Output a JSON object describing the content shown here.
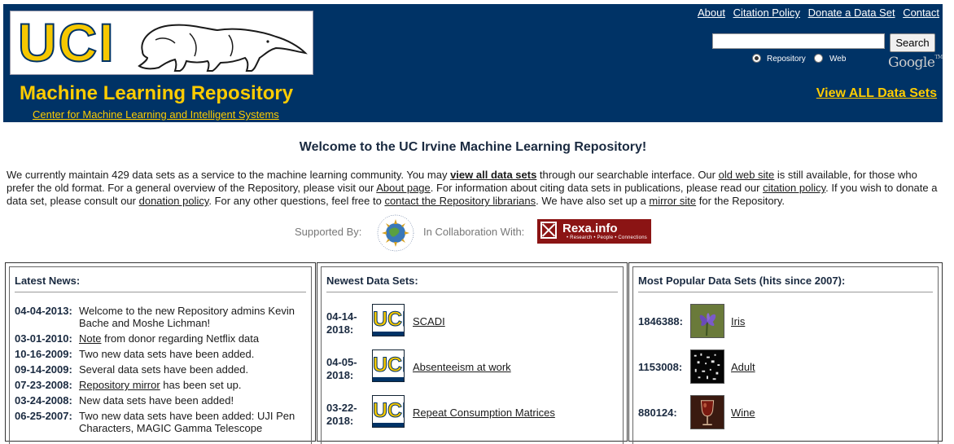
{
  "header": {
    "logo_text": "UCI",
    "title": "Machine Learning Repository",
    "subtitle": "Center for Machine Learning and Intelligent Systems",
    "top_links": [
      "About",
      "Citation Policy",
      "Donate a Data Set",
      "Contact"
    ],
    "search_value": "",
    "search_button": "Search",
    "radio_repository": "Repository",
    "radio_web": "Web",
    "radio_selected": "Repository",
    "google_logo": "Google",
    "view_all": "View ALL Data Sets",
    "brand_color": "#003366",
    "accent_color": "#ffcc00"
  },
  "welcome": {
    "heading": "Welcome to the UC Irvine Machine Learning Repository!",
    "intro_parts": [
      "We currently maintain 429 data sets as a service to the machine learning community. You may ",
      "view all data sets",
      " through our searchable interface. Our ",
      "old web site",
      " is still available, for those who prefer the old format. For a general overview of the Repository, please visit our ",
      "About page",
      ". For information about citing data sets in publications, please read our ",
      "citation policy",
      ". If you wish to donate a data set, please consult our ",
      "donation policy",
      ". For any other questions, feel free to ",
      "contact the Repository librarians",
      ". We have also set up a ",
      "mirror site",
      " for the Repository."
    ],
    "supported_by": "Supported By:",
    "collaboration": "In Collaboration With:",
    "rexa_name": "Rexa.info",
    "rexa_tagline": "• Research • People • Connections"
  },
  "news": {
    "title": "Latest News:",
    "items": [
      {
        "date": "04-04-2013:",
        "text": "Welcome to the new Repository admins Kevin Bache and Moshe Lichman!"
      },
      {
        "date": "03-01-2010:",
        "link": "Note",
        "text": " from donor regarding Netflix data"
      },
      {
        "date": "10-16-2009:",
        "text": "Two new data sets have been added."
      },
      {
        "date": "09-14-2009:",
        "text": "Several data sets have been added."
      },
      {
        "date": "07-23-2008:",
        "link": "Repository mirror",
        "text": " has been set up."
      },
      {
        "date": "03-24-2008:",
        "text": "New data sets have been added!"
      },
      {
        "date": "06-25-2007:",
        "text": "Two new data sets have been added: UJI Pen Characters, MAGIC Gamma Telescope"
      }
    ]
  },
  "newest": {
    "title": "Newest Data Sets:",
    "items": [
      {
        "date": "04-14-2018:",
        "name": "SCADI"
      },
      {
        "date": "04-05-2018:",
        "name": "Absenteeism at work"
      },
      {
        "date": "03-22-2018:",
        "name": "Repeat Consumption Matrices"
      }
    ]
  },
  "popular": {
    "title": "Most Popular Data Sets (hits since 2007):",
    "items": [
      {
        "hits": "1846388:",
        "name": "Iris"
      },
      {
        "hits": "1153008:",
        "name": "Adult"
      },
      {
        "hits": "880124:",
        "name": "Wine"
      }
    ]
  }
}
